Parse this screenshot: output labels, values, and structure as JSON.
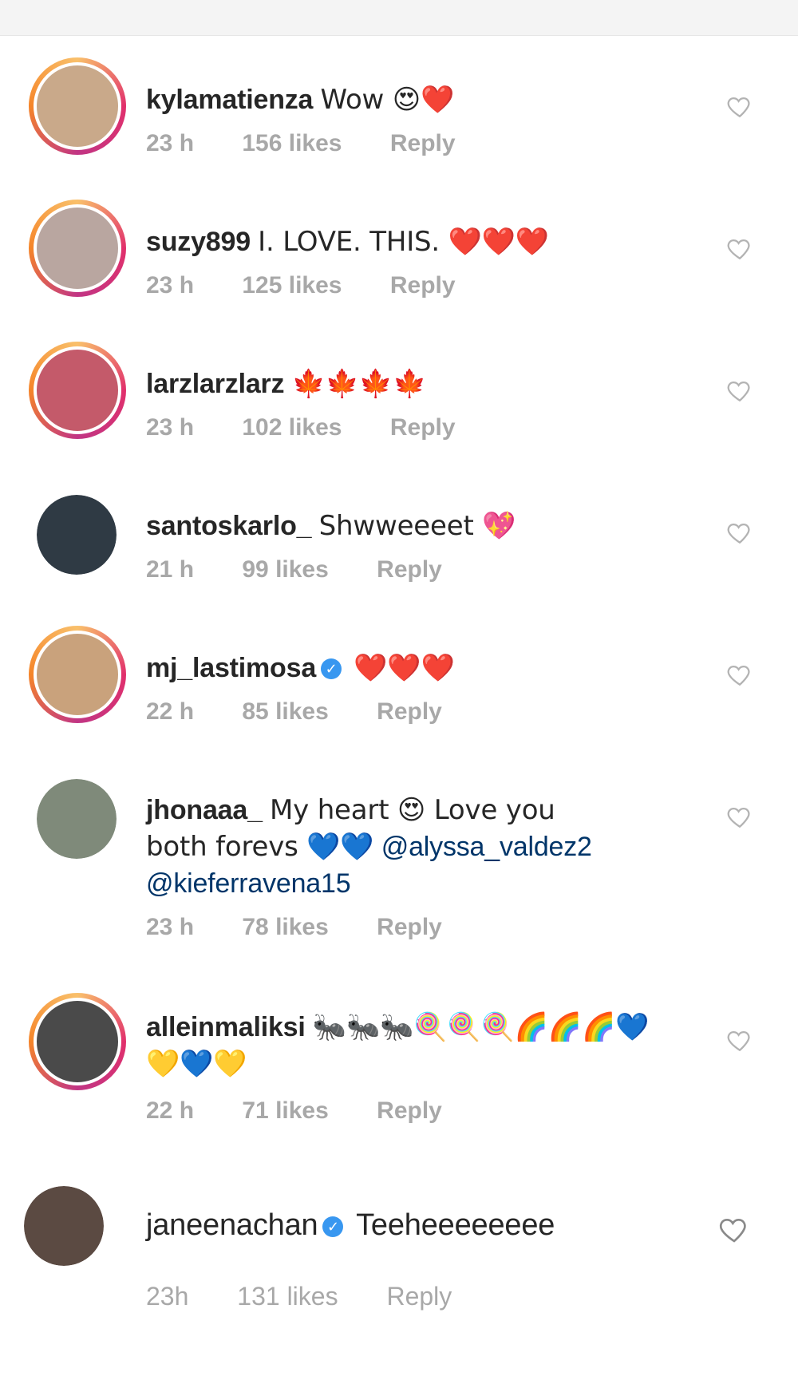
{
  "comments": [
    {
      "username": "kylamatienza",
      "text": "Wow 😍❤️",
      "time": "23 h",
      "likes": "156 likes",
      "reply": "Reply",
      "avatar_color": "#c9a98a",
      "verified": false
    },
    {
      "username": "suzy899",
      "text": "I. LOVE. THIS. ❤️❤️❤️",
      "time": "23 h",
      "likes": "125 likes",
      "reply": "Reply",
      "avatar_color": "#b9a6a0",
      "verified": false
    },
    {
      "username": "larzlarzlarz",
      "text": "🍁🍁🍁🍁",
      "time": "23 h",
      "likes": "102 likes",
      "reply": "Reply",
      "avatar_color": "#c45a6a",
      "verified": false
    },
    {
      "username": "santoskarlo_",
      "text": "Shwweeeet 💖",
      "time": "21 h",
      "likes": "99 likes",
      "reply": "Reply",
      "avatar_color": "#2f3a44",
      "verified": false
    },
    {
      "username": "mj_lastimosa",
      "text": "❤️❤️❤️",
      "time": "22 h",
      "likes": "85 likes",
      "reply": "Reply",
      "avatar_color": "#c9a27c",
      "verified": true
    },
    {
      "username": "jhonaaa_",
      "text_line1": "My heart 😍 Love you",
      "text_line2_prefix": "both forevs 💙💙",
      "mention1": "@alyssa_valdez2",
      "mention2": "@kieferravena15",
      "time": "23 h",
      "likes": "78 likes",
      "reply": "Reply",
      "avatar_color": "#7f8a7a",
      "verified": false
    },
    {
      "username": "alleinmaliksi",
      "text_line1": "🐜🐜🐜🍭🍭🍭🌈🌈🌈💙",
      "text_line2": "💛💙💛",
      "time": "22 h",
      "likes": "71 likes",
      "reply": "Reply",
      "avatar_color": "#4a4a4a",
      "verified": false
    },
    {
      "username": "janeenachan",
      "text": "Teeheeeeeeee",
      "time": "23h",
      "likes": "131 likes",
      "reply": "Reply",
      "avatar_color": "#5b4a42",
      "verified": true
    }
  ],
  "icons": {
    "heart": "heart-outline-icon",
    "verified": "verified-badge-icon"
  },
  "colors": {
    "meta_gray": "#a8a8a8",
    "verified_blue": "#3897f0",
    "mention_blue": "#003569"
  }
}
